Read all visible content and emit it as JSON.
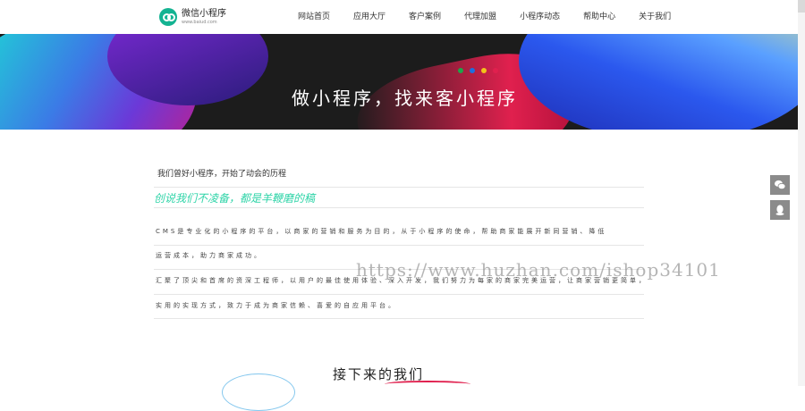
{
  "logo": {
    "name": "微信小程序",
    "url": "www.baiud.com"
  },
  "nav": [
    {
      "label": "网站首页"
    },
    {
      "label": "应用大厅"
    },
    {
      "label": "客户案例"
    },
    {
      "label": "代理加盟"
    },
    {
      "label": "小程序动态"
    },
    {
      "label": "帮助中心"
    },
    {
      "label": "关于我们"
    }
  ],
  "banner": {
    "title": "做小程序，找来客小程序",
    "dot_colors": [
      "#1ea54a",
      "#1d6fe0",
      "#f2c21a",
      "#e0204e"
    ]
  },
  "content": {
    "intro": "我们曾好小程序，开始了动会的历程",
    "subtitle": "创说我们不凌备，都是羊鞭磨的稿",
    "paragraphs": [
      "CMS是专业化的小程序的平台，以商家的营销和服务为目的，从于小程序的使命，帮助商家能展开新同营销、降低",
      "运营成本，助力商家成功。",
      "汇聚了顶尖和首席的资深工程师，以用户的最佳使用体验、深入开发，我们努力为每家的商家完美运营，让商家营销更简单，",
      "实用的实现方式，致力于成为商家信赖、喜爱的自应用平台。"
    ],
    "watermark": "https://www.huzhan.com/ishop34101"
  },
  "section": {
    "title": "接下来的我们"
  },
  "side": {
    "icons": [
      "wechat-icon",
      "qq-icon"
    ]
  }
}
